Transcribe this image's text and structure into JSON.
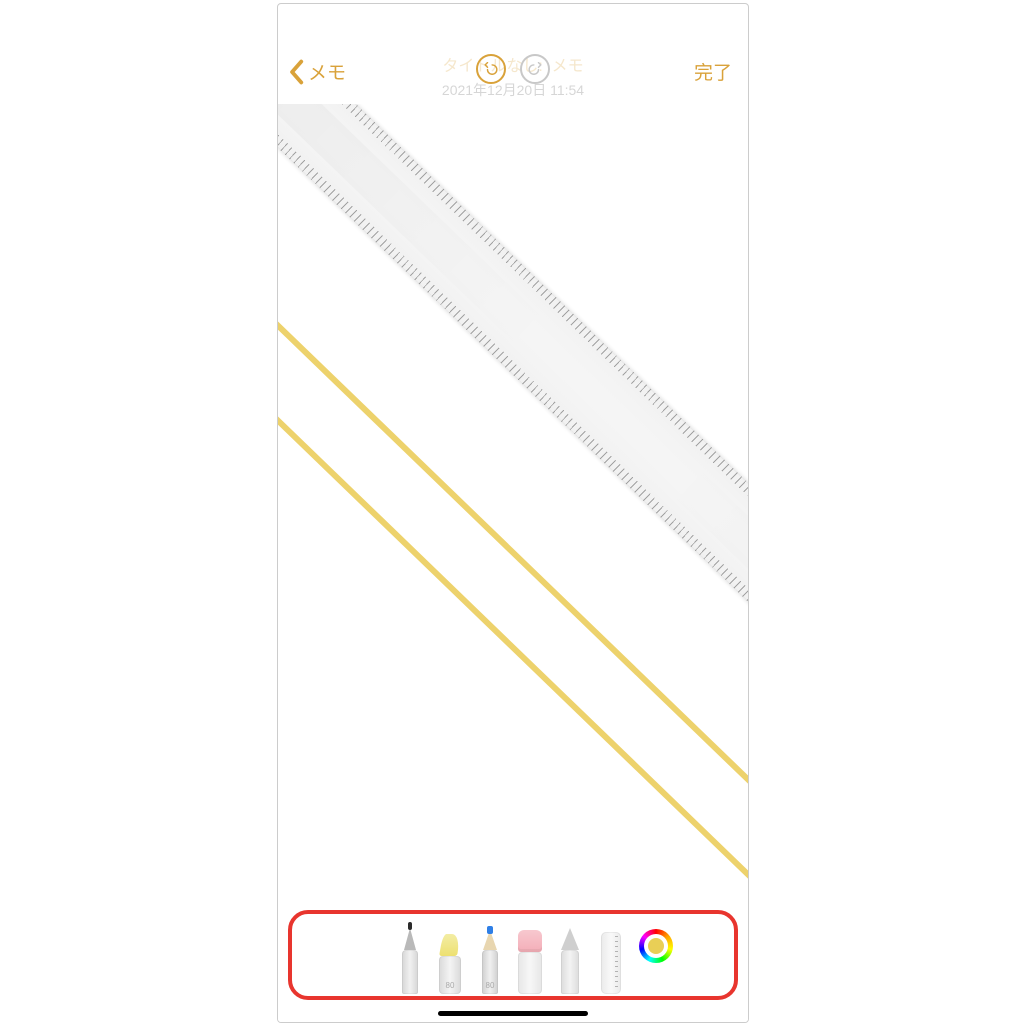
{
  "nav": {
    "back_label": "メモ",
    "done_label": "完了",
    "title_line1": "タイトルなし",
    "title_line2": "メモ",
    "date": "2021年12月20日 11:54",
    "undo_enabled": true,
    "redo_enabled": false,
    "accent_color": "#d9a23a"
  },
  "canvas": {
    "ruler": {
      "angle_deg": 44,
      "visible": true
    },
    "stroke_color": "#edd26c"
  },
  "toolbar": {
    "tools": [
      {
        "id": "pen",
        "label": ""
      },
      {
        "id": "highlighter",
        "label": "80"
      },
      {
        "id": "pencil",
        "label": "80"
      },
      {
        "id": "eraser",
        "label": ""
      },
      {
        "id": "lasso",
        "label": ""
      },
      {
        "id": "ruler",
        "label": ""
      }
    ],
    "color_swatch": "#e9cf56",
    "highlight_annotation": true
  }
}
